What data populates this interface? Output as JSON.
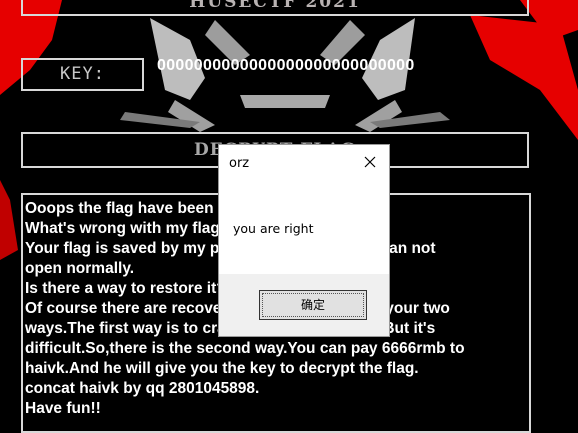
{
  "app": {
    "title": "HUSECTF 2021",
    "key_label": "KEY:",
    "key_value": "0000000000000000000000000000",
    "decrypt_button_label": "DECRYPT FLAG",
    "message_lines": [
      "Ooops the flag have been encrypted!",
      "What's wrong with my flag?",
      "Your flag is saved by my program and therefore can not",
      "open normally.",
      "Is there a way to restore it?",
      "Of course there are recovery methods.I'm giving your two",
      "ways.The first way is to crack the program's key.But it's",
      "difficult.So,there is the second way.You can pay 6666rmb to",
      "haivk.And he will give you the key to decrypt the flag.",
      "concat haivk by qq 2801045898.",
      "Have fun!!"
    ]
  },
  "dialog": {
    "title": "orz",
    "message": "you are right",
    "ok_label": "确定",
    "close_icon": "close-icon"
  },
  "colors": {
    "background": "#000000",
    "accent_red": "#e60000",
    "panel_border": "#d8d8d8",
    "text": "#ffffff"
  }
}
